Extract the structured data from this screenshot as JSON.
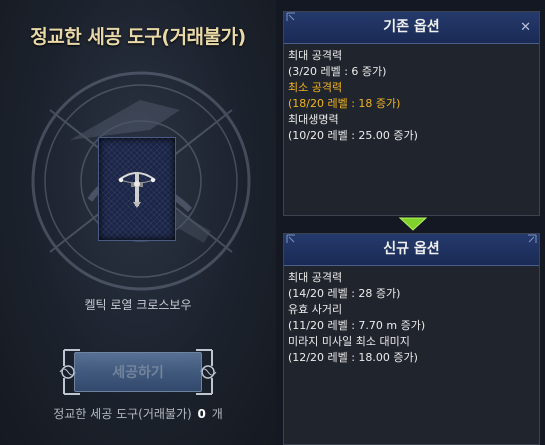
{
  "left": {
    "title": "정교한 세공 도구(거래불가)",
    "item_name": "켈틱 로열 크로스보우",
    "craft_button": "세공하기",
    "tool_label": "정교한 세공 도구(거래불가)",
    "tool_count": "0",
    "tool_unit": "개"
  },
  "existing": {
    "title": "기존 옵션",
    "lines": [
      {
        "text": "최대 공격력",
        "highlight": false
      },
      {
        "text": "(3/20 레벨 : 6 증가)",
        "highlight": false
      },
      {
        "text": "최소 공격력",
        "highlight": true
      },
      {
        "text": "(18/20 레벨 : 18 증가)",
        "highlight": true
      },
      {
        "text": "최대생명력",
        "highlight": false
      },
      {
        "text": "(10/20 레벨 : 25.00 증가)",
        "highlight": false
      }
    ]
  },
  "new": {
    "title": "신규 옵션",
    "lines": [
      {
        "text": "최대 공격력",
        "highlight": false
      },
      {
        "text": "(14/20 레벨 : 28 증가)",
        "highlight": false
      },
      {
        "text": "유효 사거리",
        "highlight": false
      },
      {
        "text": "(11/20 레벨 : 7.70 m 증가)",
        "highlight": false
      },
      {
        "text": "미라지 미사일 최소 대미지",
        "highlight": false
      },
      {
        "text": "(12/20 레벨 : 18.00 증가)",
        "highlight": false
      }
    ]
  },
  "icons": {
    "item": "crossbow-icon",
    "arrow": "arrow-down-icon",
    "close": "close-icon"
  },
  "colors": {
    "highlight": "#f2b41f",
    "arrow": "#7fd22a",
    "header_bg": "#1f3160",
    "title_gold": "#e9d9a8"
  }
}
